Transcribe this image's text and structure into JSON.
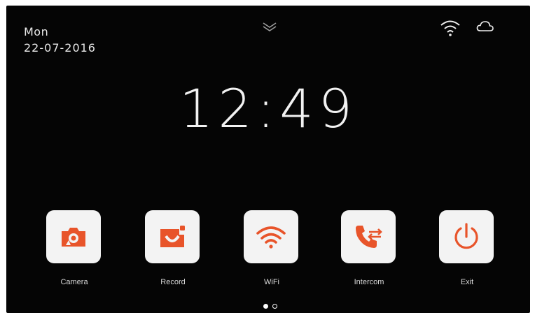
{
  "status": {
    "day": "Mon",
    "date": "22-07-2016",
    "icons": [
      "chevron-down-icon",
      "wifi-icon",
      "cloud-icon"
    ]
  },
  "clock": {
    "time": "12:49"
  },
  "accent_color": "#e8542a",
  "apps": [
    {
      "label": "Camera",
      "icon": "camera-icon"
    },
    {
      "label": "Record",
      "icon": "record-icon"
    },
    {
      "label": "WiFi",
      "icon": "wifi-icon"
    },
    {
      "label": "Intercom",
      "icon": "intercom-phone-icon"
    },
    {
      "label": "Exit",
      "icon": "power-icon"
    }
  ],
  "pager": {
    "pages": 2,
    "current": 1
  }
}
